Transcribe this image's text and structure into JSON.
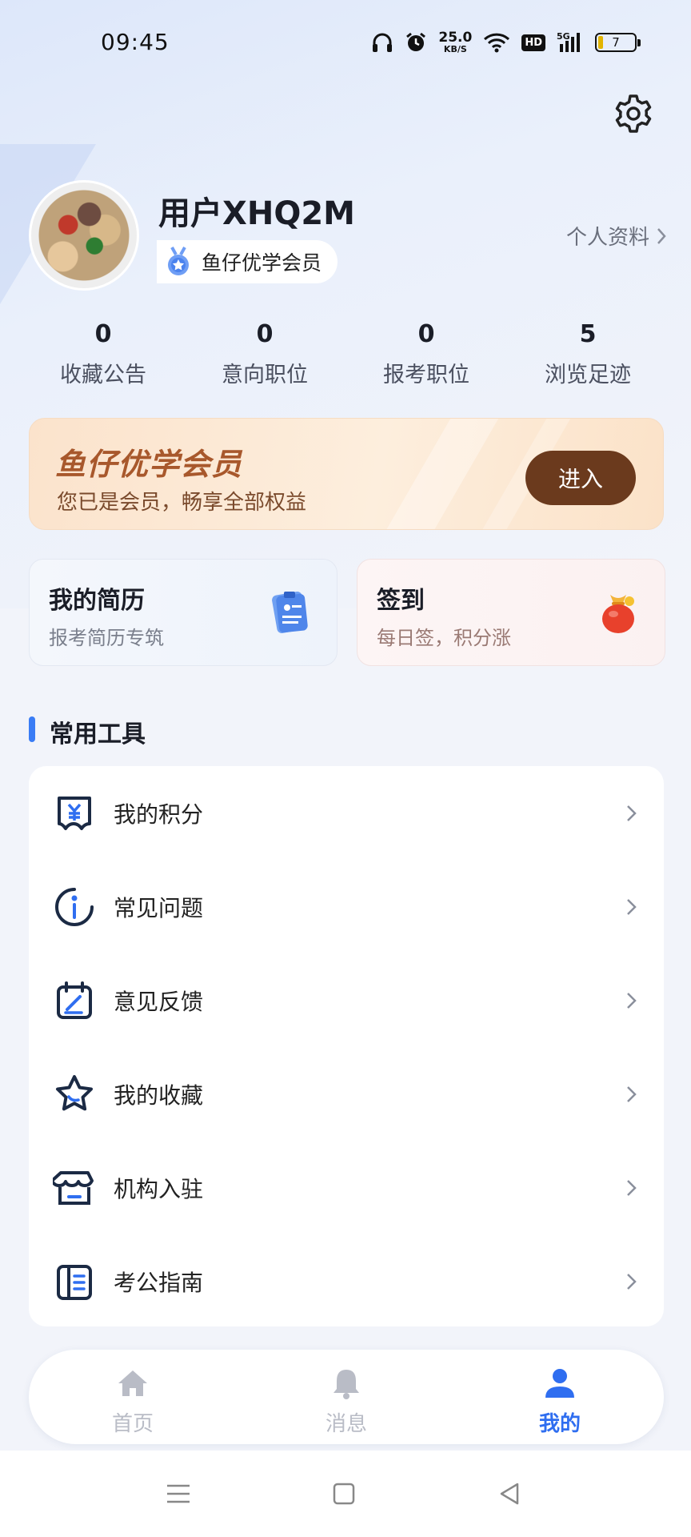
{
  "status_bar": {
    "time": "09:45",
    "net_speed_value": "25.0",
    "net_speed_unit": "KB/S",
    "hd": "HD",
    "network": "5G",
    "battery_level": "7"
  },
  "profile": {
    "username": "用户XHQ2M",
    "member_label": "鱼仔优学会员",
    "profile_link": "个人资料"
  },
  "stats": [
    {
      "value": "0",
      "label": "收藏公告"
    },
    {
      "value": "0",
      "label": "意向职位"
    },
    {
      "value": "0",
      "label": "报考职位"
    },
    {
      "value": "5",
      "label": "浏览足迹"
    }
  ],
  "vip_card": {
    "title": "鱼仔优学会员",
    "subtitle": "您已是会员，畅享全部权益",
    "button": "进入"
  },
  "quick_cards": {
    "resume": {
      "title": "我的简历",
      "subtitle": "报考简历专筑"
    },
    "signin": {
      "title": "签到",
      "subtitle": "每日签，积分涨"
    }
  },
  "tools_section": {
    "title": "常用工具",
    "items": [
      {
        "label": "我的积分",
        "icon": "points-icon"
      },
      {
        "label": "常见问题",
        "icon": "info-icon"
      },
      {
        "label": "意见反馈",
        "icon": "feedback-icon"
      },
      {
        "label": "我的收藏",
        "icon": "star-icon"
      },
      {
        "label": "机构入驻",
        "icon": "store-icon"
      },
      {
        "label": "考公指南",
        "icon": "guide-icon"
      }
    ]
  },
  "tabbar": {
    "home": "首页",
    "messages": "消息",
    "mine": "我的",
    "active": "mine",
    "active_color": "#2f6ef0",
    "inactive_color": "#b9bcc6"
  },
  "colors": {
    "accent": "#3a7cf5",
    "vip_button": "#6b3a1d",
    "vip_title": "#a8582c"
  }
}
